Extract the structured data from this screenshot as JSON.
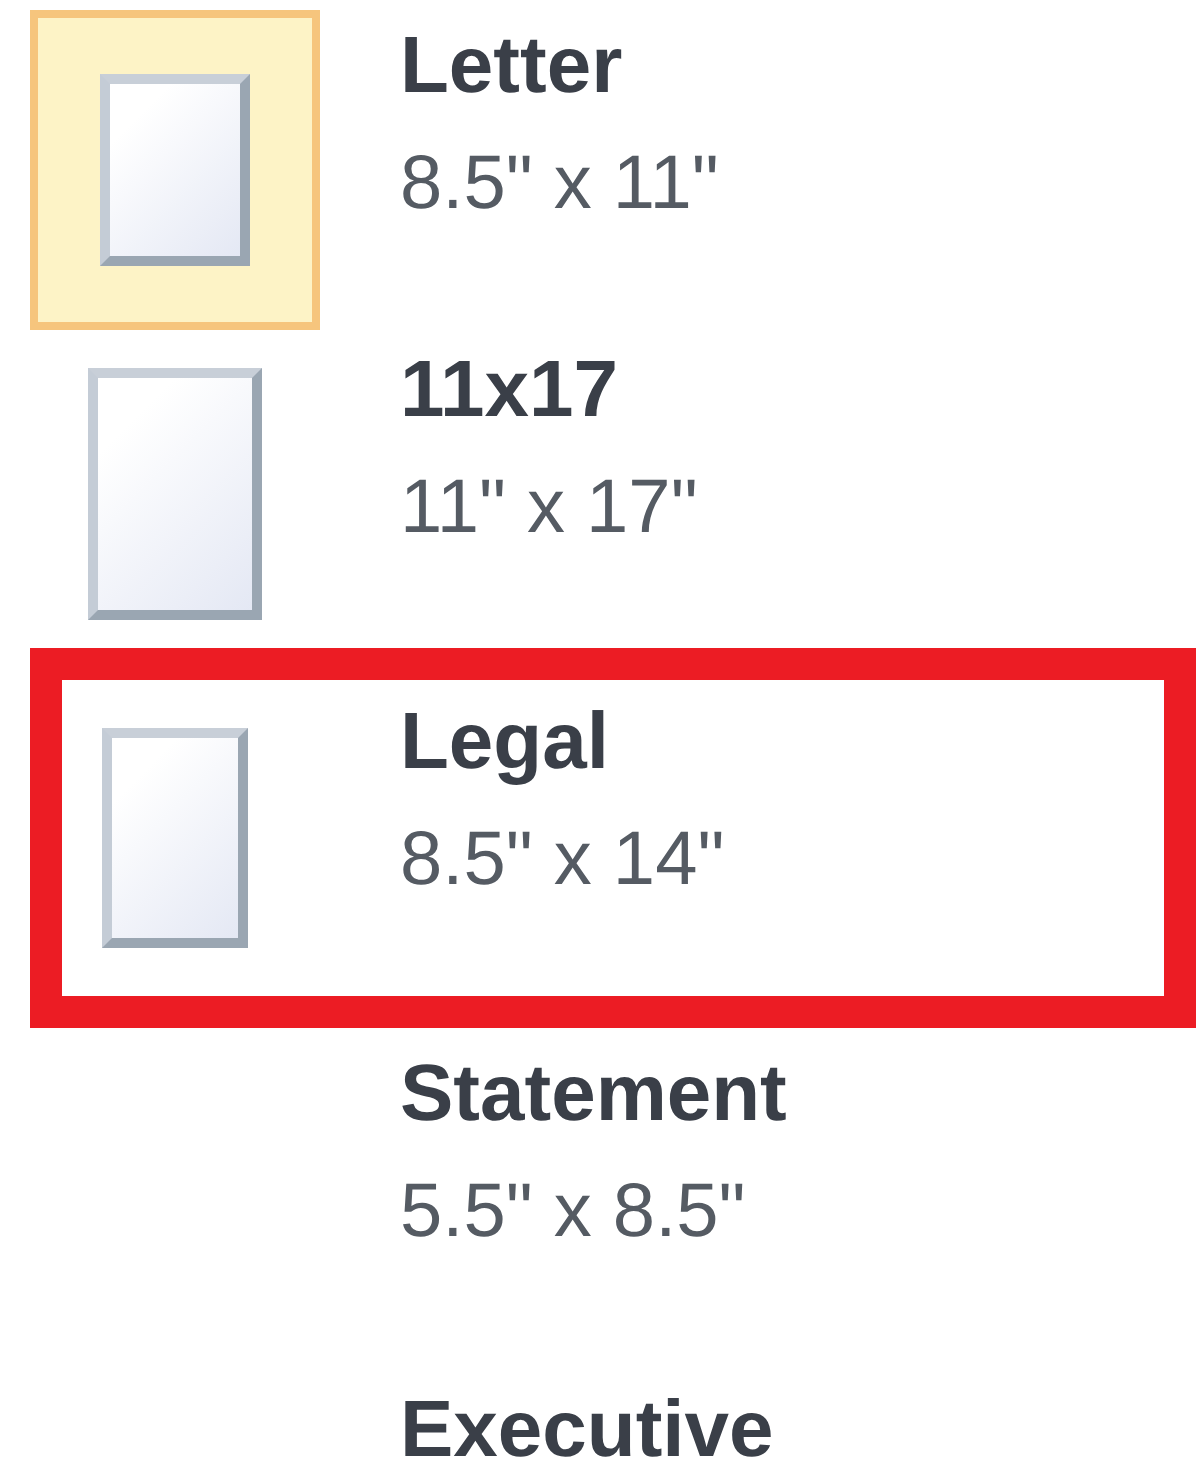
{
  "paper_sizes": [
    {
      "name": "Letter",
      "size": "8.5\" x 11\"",
      "kind": "page",
      "selected": true,
      "annotated": false
    },
    {
      "name": "11x17",
      "size": "11\" x 17\"",
      "kind": "tall-page",
      "selected": false,
      "annotated": false
    },
    {
      "name": "Legal",
      "size": "8.5\" x 14\"",
      "kind": "narrow-page",
      "selected": false,
      "annotated": true
    },
    {
      "name": "Statement",
      "size": "5.5\" x 8.5\"",
      "kind": "blank",
      "selected": false,
      "annotated": false
    },
    {
      "name": "Executive",
      "kind": "blank",
      "selected": false,
      "annotated": false
    }
  ]
}
